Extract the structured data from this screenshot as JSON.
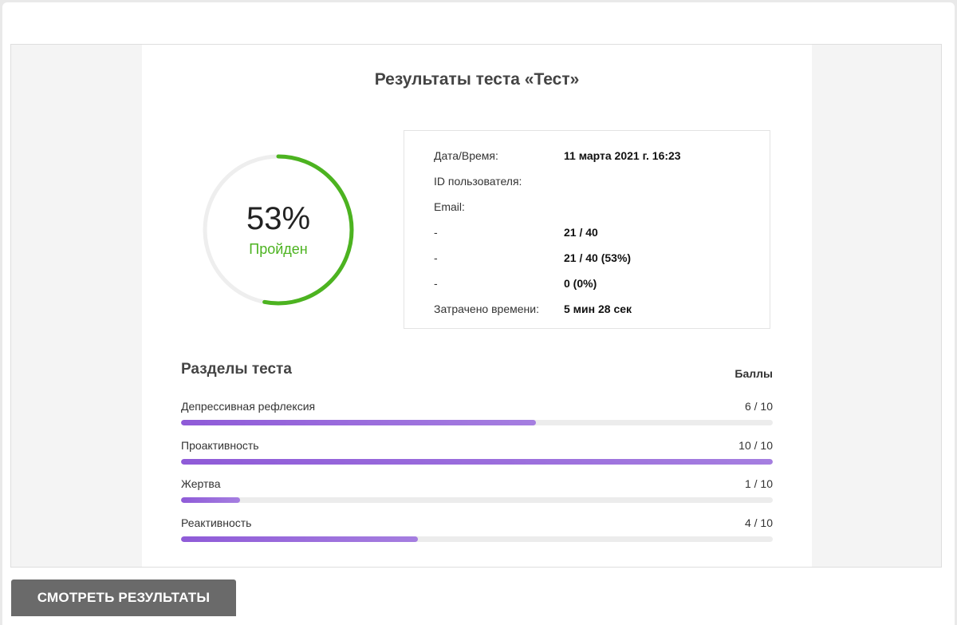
{
  "title": "Результаты теста «Тест»",
  "result": {
    "percent": 53,
    "percent_label": "53%",
    "status": "Пройден",
    "colors": {
      "progress": "#4cb320",
      "track": "#eeeeee"
    }
  },
  "info": [
    {
      "label": "Дата/Время:",
      "value": "11 марта 2021 г. 16:23"
    },
    {
      "label": "ID пользователя:",
      "value": ""
    },
    {
      "label": "Email:",
      "value": ""
    },
    {
      "label": "-",
      "value": "21 / 40"
    },
    {
      "label": "-",
      "value": "21 / 40 (53%)"
    },
    {
      "label": "-",
      "value": "0 (0%)"
    },
    {
      "label": "Затрачено времени:",
      "value": "5 мин 28 сек"
    }
  ],
  "sections": {
    "title": "Разделы теста",
    "score_header": "Баллы",
    "items": [
      {
        "label": "Депрессивная рефлексия",
        "score": "6 / 10",
        "value": 6,
        "max": 10
      },
      {
        "label": "Проактивность",
        "score": "10 / 10",
        "value": 10,
        "max": 10
      },
      {
        "label": "Жертва",
        "score": "1 / 10",
        "value": 1,
        "max": 10
      },
      {
        "label": "Реактивность",
        "score": "4 / 10",
        "value": 4,
        "max": 10
      }
    ]
  },
  "button": {
    "label": "СМОТРЕТЬ РЕЗУЛЬТАТЫ",
    "color": "#6a6a6a"
  }
}
